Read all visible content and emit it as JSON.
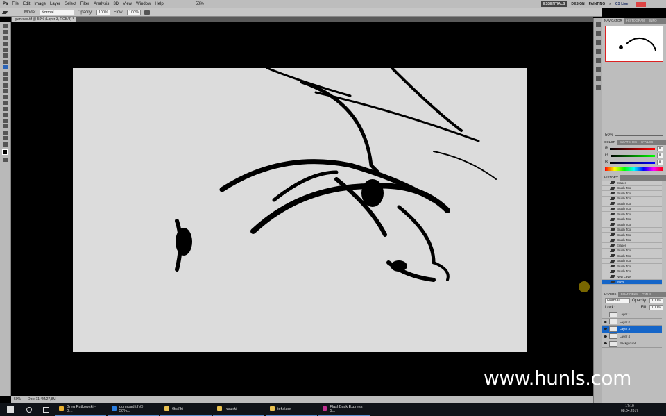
{
  "app": {
    "logo": "Ps",
    "menu": [
      "File",
      "Edit",
      "Image",
      "Layer",
      "Select",
      "Filter",
      "Analysis",
      "3D",
      "View",
      "Window",
      "Help"
    ],
    "zoom": "50%"
  },
  "workspace": {
    "items": [
      "ESSENTIALS",
      "DESIGN",
      "PAINTING",
      "»"
    ],
    "cslive": "CS Live"
  },
  "options": {
    "mode_label": "Mode:",
    "mode": "Normal",
    "opacity_label": "Opacity:",
    "opacity": "100%",
    "flow_label": "Flow:",
    "flow": "100%"
  },
  "document": {
    "tab": "gumroad.tif @ 50% (Layer 3, RGB/8) *"
  },
  "navigator": {
    "tabs": [
      "NAVIGATOR",
      "HISTOGRAM",
      "INFO"
    ],
    "zoom": "50%"
  },
  "color": {
    "tabs": [
      "COLOR",
      "SWATCHES",
      "STYLES"
    ],
    "channels": [
      {
        "label": "R",
        "value": "0"
      },
      {
        "label": "G",
        "value": "0"
      },
      {
        "label": "B",
        "value": "0"
      }
    ]
  },
  "history": {
    "title": "HISTORY",
    "items": [
      "Eraser",
      "Brush Tool",
      "Brush Tool",
      "Brush Tool",
      "Brush Tool",
      "Brush Tool",
      "Brush Tool",
      "Brush Tool",
      "Brush Tool",
      "Brush Tool",
      "Brush Tool",
      "Brush Tool",
      "Eraser",
      "Brush Tool",
      "Brush Tool",
      "Brush Tool",
      "Brush Tool",
      "Brush Tool",
      "New Layer",
      "Move"
    ],
    "selected": 19
  },
  "layers": {
    "tabs": [
      "LAYERS",
      "CHANNELS",
      "PATHS"
    ],
    "blend": "Normal",
    "opacity_label": "Opacity:",
    "opacity": "100%",
    "lock_label": "Lock:",
    "fill_label": "Fill:",
    "fill": "100%",
    "items": [
      "Layer 1",
      "Layer 2",
      "Layer 3",
      "Layer 4",
      "Background"
    ],
    "selected": 2
  },
  "status": {
    "zoom": "50%",
    "doc": "Doc: 11,4M/27,8M"
  },
  "taskbar": {
    "items": [
      {
        "label": "Greg Rutkowski - G...",
        "color": "#e8b030"
      },
      {
        "label": "gumroad.tif @ 50%...",
        "color": "#2a7de0"
      },
      {
        "label": "Grafiki",
        "color": "#e8c050"
      },
      {
        "label": "rysunki",
        "color": "#e8c050"
      },
      {
        "label": "tekstury",
        "color": "#e8c050"
      },
      {
        "label": "FlashBack Express 5...",
        "color": "#c03090"
      }
    ],
    "time": "17:10",
    "date": "08.04.2017"
  },
  "watermark": "www.hunls.com"
}
